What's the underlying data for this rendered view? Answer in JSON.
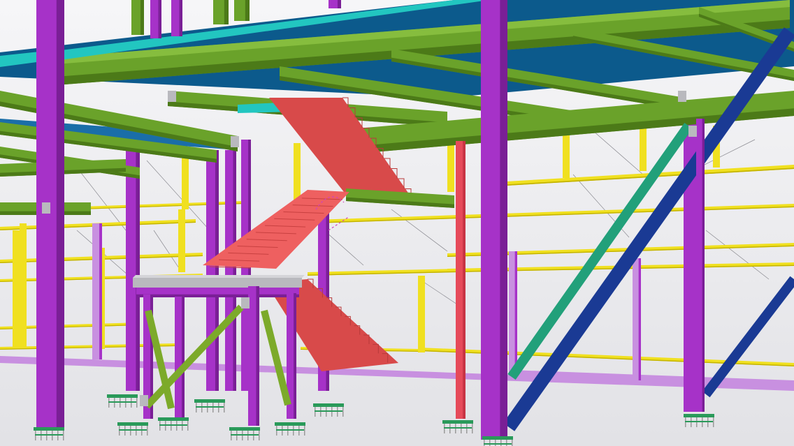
{
  "viewport": {
    "kind": "3d-structural-model-view",
    "background_top": "#f6f6f8",
    "background_bottom": "#e2e2e6"
  },
  "colors": {
    "column": "#a632c8",
    "column_dark": "#7a1f96",
    "column_light": "#c060e0",
    "beam": "#6aa22a",
    "beam_dark": "#4c7a18",
    "beam_light": "#86bd3e",
    "deck": "#0c5a8c",
    "deck_light": "#1a6ea8",
    "cyan_member": "#22c6c0",
    "rail": "#f0e020",
    "rail_dark": "#c4b400",
    "stair": "#d84a4a",
    "stair_light": "#ee6060",
    "red_column": "#e64a5a",
    "teal_brace": "#22a07a",
    "navy_brace": "#1a3a94",
    "platform": "#b9b9be",
    "brace_green": "#7caa2a",
    "base_plate": "#2a9a5a",
    "lilac": "#c890e0",
    "bolt": "#9a9a9a"
  }
}
